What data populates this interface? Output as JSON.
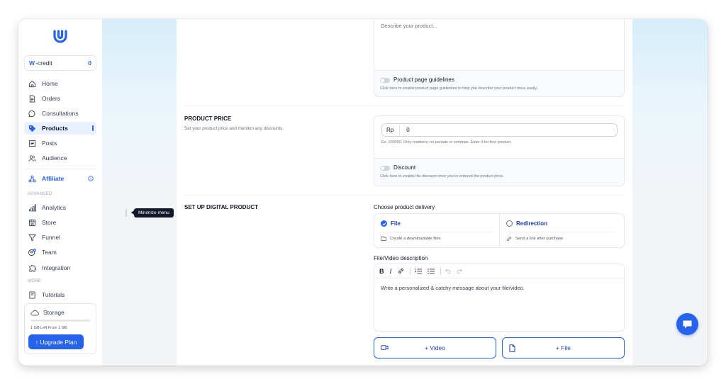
{
  "sidebar": {
    "credit": {
      "prefix": "W",
      "label": "-credit",
      "value": "0"
    },
    "items": [
      {
        "label": "Home",
        "icon": "home-icon"
      },
      {
        "label": "Orders",
        "icon": "document-icon"
      },
      {
        "label": "Consultations",
        "icon": "chat-bubble-icon"
      },
      {
        "label": "Products",
        "icon": "tag-icon",
        "active": true
      },
      {
        "label": "Posts",
        "icon": "newspaper-icon"
      },
      {
        "label": "Audience",
        "icon": "users-icon"
      }
    ],
    "affiliate": {
      "label": "Affiliate",
      "icon": "affiliate-icon"
    },
    "advanced_label": "ADVANCED",
    "advanced_items": [
      {
        "label": "Analytics",
        "icon": "bar-chart-icon"
      },
      {
        "label": "Store",
        "icon": "store-icon"
      },
      {
        "label": "Funnel",
        "icon": "funnel-icon"
      },
      {
        "label": "Team",
        "icon": "team-icon"
      },
      {
        "label": "Integration",
        "icon": "puzzle-icon"
      }
    ],
    "more_label": "MORE",
    "more_items": [
      {
        "label": "Tutorials",
        "icon": "book-icon"
      }
    ],
    "storage": {
      "title": "Storage",
      "left_text": "1 GB Left From 1 GB",
      "used_fraction": 0,
      "upgrade_label": "↑ Upgrade Plan"
    }
  },
  "tooltip": {
    "text": "Minimize menu"
  },
  "description": {
    "placeholder": "Describe your product...",
    "guidelines_title": "Product page guidelines",
    "guidelines_sub": "Click here to enable product page guidelines to help you describe your product more easily."
  },
  "price": {
    "title": "PRODUCT PRICE",
    "subtitle": "Set your product price and mention any discounts.",
    "currency": "Rp",
    "value": "0",
    "hint": "Ex. 100000. Only numbers; no periods or commas. Enter 0 for free product.",
    "discount_title": "Discount",
    "discount_sub": "Click here to enable the discount once you've entered the product price."
  },
  "digital": {
    "title": "SET UP DIGITAL PRODUCT",
    "delivery_label": "Choose product delivery",
    "options": [
      {
        "label": "File",
        "sub": "Create a downloadable files",
        "selected": true
      },
      {
        "label": "Redirection",
        "sub": "Send a link after purchase",
        "selected": false
      }
    ],
    "desc_label": "File/Video description",
    "editor_placeholder": "Write a personalized & catchy message about your file/video.",
    "add_video": "+ Video",
    "add_file": "+ File"
  },
  "colors": {
    "accent": "#2563eb",
    "active_bg": "#e8f1fd"
  }
}
